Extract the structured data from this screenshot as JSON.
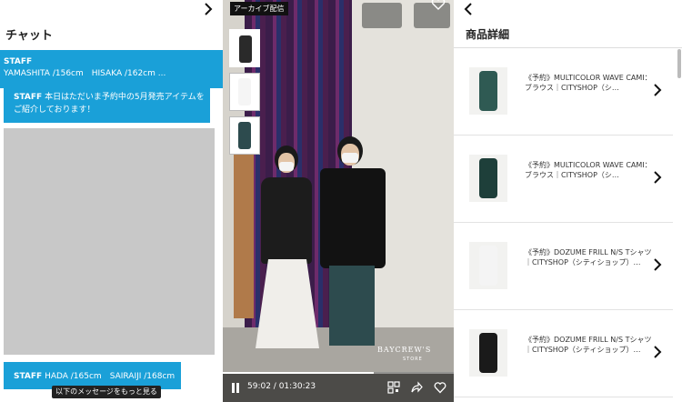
{
  "chat": {
    "title": "チャット",
    "header_label": "STAFF",
    "header_text": "YAMASHITA /156cm　HISAKA /162cm ...",
    "message_label": "STAFF",
    "message_text": "本日はただいま予約中の5月発売アイテムをご紹介しております！",
    "bottom_label": "STAFF",
    "bottom_text": "HADA /165cm　SAIRAIJI /168cm",
    "more_button": "以下のメッセージをもっと見る"
  },
  "video": {
    "badge": "アーカイブ配信",
    "brand": "BAYCREW'S",
    "brand_sub": "STORE",
    "time": "59:02 / 01:30:23",
    "progress": 0.6533,
    "thumbs": [
      {
        "color": "#2a2a2a"
      },
      {
        "color": "#f5f5f5"
      },
      {
        "color": "#2d4b4e"
      }
    ]
  },
  "detail": {
    "title": "商品詳細",
    "products": [
      {
        "name": "《予約》MULTICOLOR WAVE CAMI：ブラウス｜CITYSHOP（シ…",
        "fig_color": "#2f5a53"
      },
      {
        "name": "《予約》MULTICOLOR WAVE CAMI：ブラウス｜CITYSHOP（シ…",
        "fig_color": "#1e3f3a"
      },
      {
        "name": "《予約》DOZUME FRILL N/S Tシャツ｜CITYSHOP（シティショップ）…",
        "fig_color": "#f4f4f4"
      },
      {
        "name": "《予約》DOZUME FRILL N/S Tシャツ｜CITYSHOP（シティショップ）…",
        "fig_color": "#1a1a1a"
      }
    ]
  }
}
